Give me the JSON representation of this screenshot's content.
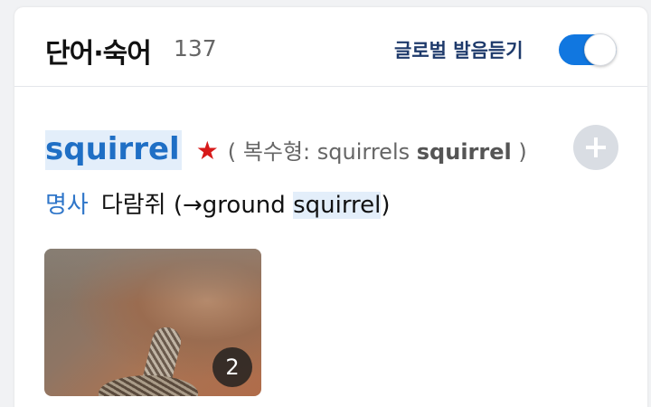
{
  "header": {
    "title": "단어·숙어",
    "count": "137",
    "global_pronunciation_label": "글로벌 발음듣기",
    "global_pronunciation_enabled": true
  },
  "entry": {
    "word": "squirrel",
    "star_icon": "star-icon",
    "plural_open": "(",
    "plural_label": "복수형:",
    "plural_form": "squirrels",
    "plural_base": "squirrel",
    "plural_close": ")",
    "add_icon": "plus-icon",
    "part_of_speech": "명사",
    "meaning_prefix": "다람쥐 (→ground ",
    "meaning_highlight": "squirrel",
    "meaning_suffix": ")"
  },
  "image": {
    "count_badge": "2"
  },
  "colors": {
    "accent": "#1177e0",
    "word": "#1f6fc5",
    "highlight": "#e3eefa",
    "star": "#d71a1a",
    "header_label": "#1e3a6b"
  }
}
